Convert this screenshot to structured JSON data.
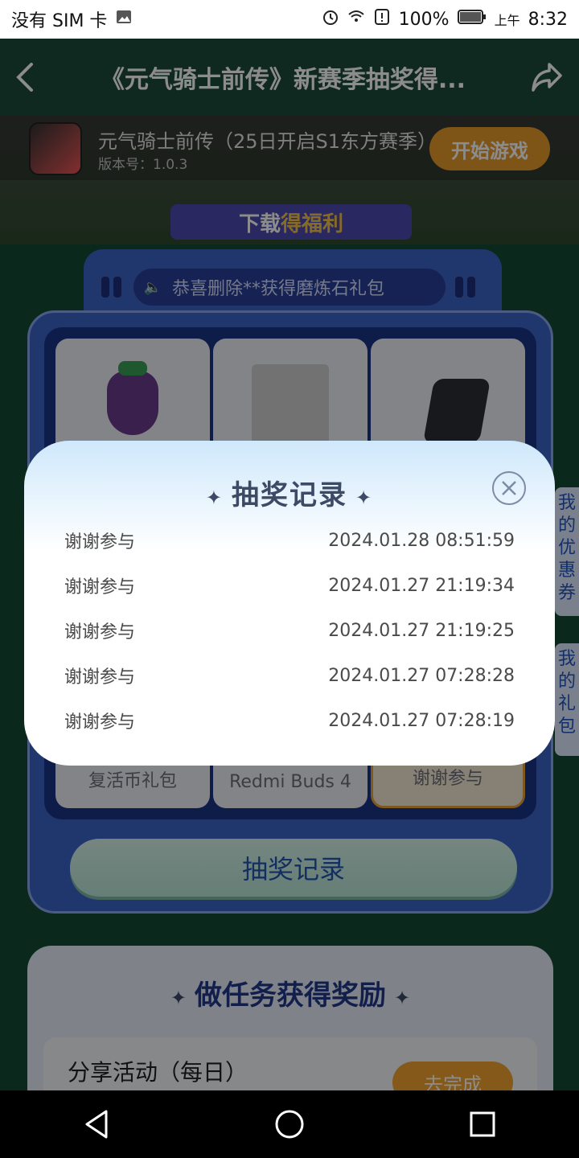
{
  "status_bar": {
    "carrier": "没有 SIM 卡",
    "battery": "100%",
    "am_pm": "上午",
    "time": "8:32"
  },
  "top_bar": {
    "title": "《元气骑士前传》新赛季抽奖得..."
  },
  "banner": {
    "game_name": "元气骑士前传（25日开启S1东方赛季）",
    "version": "版本号：1.0.3",
    "start_button": "开始游戏",
    "ribbon_prefix": "下载",
    "ribbon_highlight": "得福利"
  },
  "lottery": {
    "notice": "恭喜删除**获得磨炼石礼包",
    "bottom_row_labels": [
      "复活币礼包",
      "Redmi Buds 4",
      "谢谢参与"
    ],
    "record_button": "抽奖记录"
  },
  "side_tabs": {
    "coupons": "我的优惠券",
    "gifts": "我的礼包"
  },
  "tasks": {
    "title": "做任务获得奖励",
    "first_task": "分享活动（每日）",
    "first_task_button": "去完成"
  },
  "modal": {
    "title": "抽奖记录",
    "records": [
      {
        "prize": "谢谢参与",
        "time": "2024.01.28 08:51:59"
      },
      {
        "prize": "谢谢参与",
        "time": "2024.01.27 21:19:34"
      },
      {
        "prize": "谢谢参与",
        "time": "2024.01.27 21:19:25"
      },
      {
        "prize": "谢谢参与",
        "time": "2024.01.27 07:28:28"
      },
      {
        "prize": "谢谢参与",
        "time": "2024.01.27 07:28:19"
      }
    ]
  }
}
